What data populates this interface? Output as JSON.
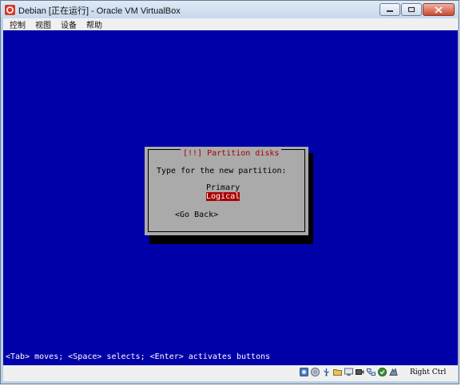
{
  "window": {
    "title": "Debian [正在运行] - Oracle VM VirtualBox",
    "icon": "virtualbox-app-icon"
  },
  "menubar": {
    "items": [
      "控制",
      "视图",
      "设备",
      "帮助"
    ]
  },
  "installer": {
    "dialog_title": "[!!] Partition disks",
    "prompt": "Type for the new partition:",
    "options": [
      {
        "label": "Primary",
        "selected": false
      },
      {
        "label": "Logical",
        "selected": true
      }
    ],
    "back_button": "<Go Back>",
    "help_line": "<Tab> moves; <Space> selects; <Enter> activates buttons"
  },
  "statusbar": {
    "icons": [
      "hard-disk-icon",
      "optical-drive-icon",
      "usb-icon",
      "shared-folders-icon",
      "display-icon",
      "video-capture-icon",
      "network-icon",
      "mouse-integration-icon",
      "host-key-icon"
    ],
    "host_key": "Right Ctrl"
  },
  "colors": {
    "screen_bg": "#0000a8",
    "dialog_bg": "#aaaaaa",
    "title_red": "#a80000",
    "highlight": "#a80000"
  }
}
